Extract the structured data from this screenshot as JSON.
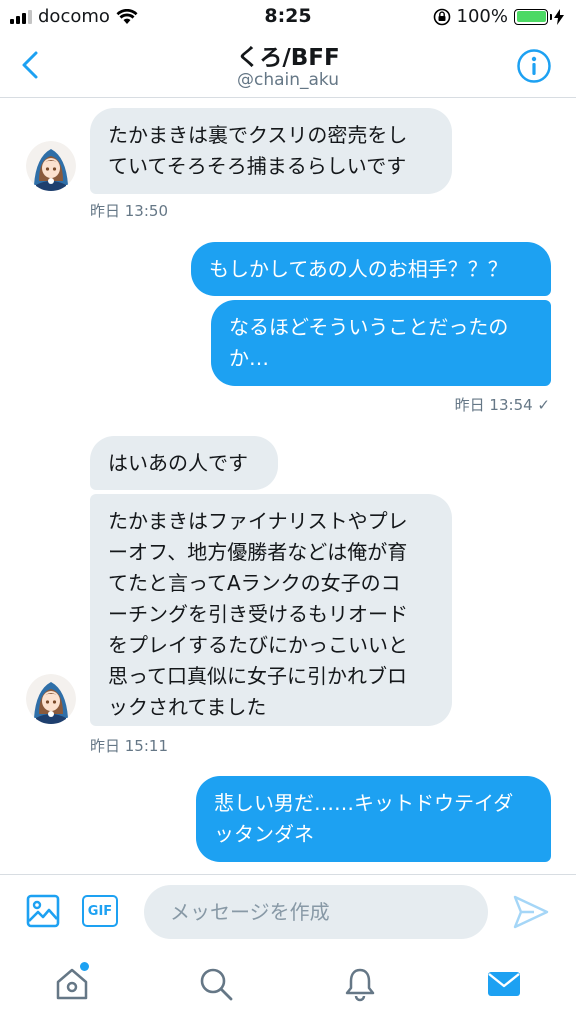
{
  "status_bar": {
    "carrier": "docomo",
    "time": "8:25",
    "battery": "100%",
    "battery_level": 1.0
  },
  "header": {
    "title": "くろ/BFF",
    "subtitle": "@chain_aku"
  },
  "messages": [
    {
      "direction": "received",
      "text": "たかまきは裏でクスリの密売をし\nていてそろそろ捕まるらしいです"
    },
    {
      "direction": "received_timestamp",
      "text": "昨日 13:50"
    },
    {
      "direction": "sent",
      "text": "もしかしてあの人のお相手？？？"
    },
    {
      "direction": "sent",
      "text": "なるほどそういうことだったの\nか…"
    },
    {
      "direction": "sent_timestamp",
      "text": "昨日 13:54 ✓"
    },
    {
      "direction": "received",
      "text": "はいあの人です"
    },
    {
      "direction": "received",
      "text": "たかまきはファイナリストやプレ\nーオフ、地方優勝者などは俺が育\nてたと言ってAランクの女子のコ\nーチングを引き受けるもリオード\nをプレイするたびにかっこいいと\n思って口真似に女子に引かれブロ\nックされてました"
    },
    {
      "direction": "received_timestamp",
      "text": "昨日 15:11"
    },
    {
      "direction": "sent",
      "text": "悲しい男だ……キットドウテイダ\nッタンダネ"
    }
  ],
  "compose": {
    "placeholder": "メッセージを作成",
    "gif_label": "GIF"
  },
  "icons": {
    "back": "chevron-left-icon",
    "info": "info-icon",
    "image": "image-icon",
    "send": "send-icon",
    "tabs": [
      "home-icon",
      "search-icon",
      "bell-icon",
      "mail-icon"
    ]
  },
  "colors": {
    "accent": "#1da1f2",
    "received_bubble": "#e6ecf0",
    "secondary_text": "#657786"
  }
}
